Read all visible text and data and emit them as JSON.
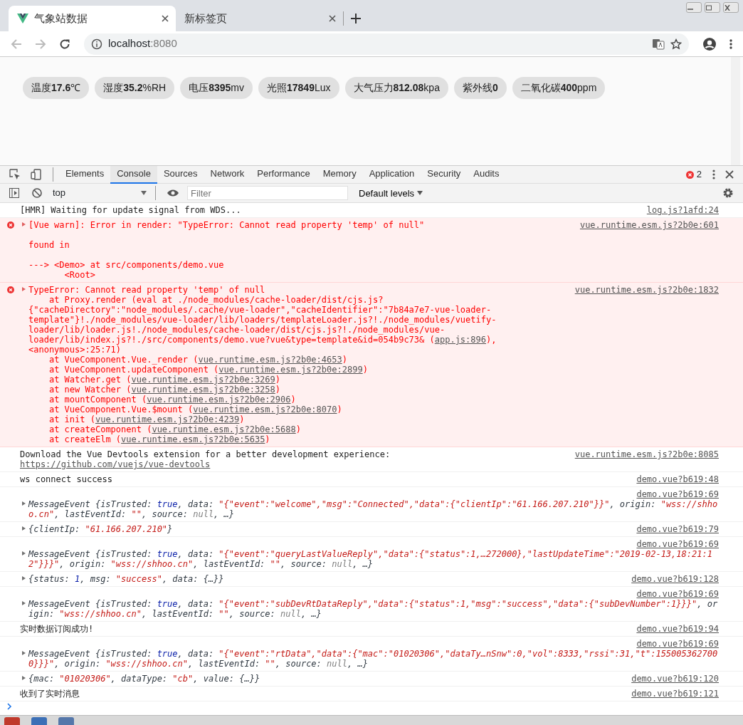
{
  "browser": {
    "tabs": [
      {
        "title": "气象站数据",
        "selected": true
      },
      {
        "title": "新标签页",
        "selected": false
      }
    ],
    "address": {
      "host": "localhost",
      "port": ":8080"
    }
  },
  "page": {
    "readings": [
      {
        "text": "温度**17.6**℃"
      },
      {
        "text": "湿度**35.2**%RH"
      },
      {
        "text": "电压**8395**mv"
      },
      {
        "text": "光照**17849**Lux"
      },
      {
        "text": "大气压力**812.08**kpa"
      },
      {
        "text": "紫外线**0**"
      },
      {
        "text": "二氧化碳**400**ppm"
      }
    ]
  },
  "devtools": {
    "tabs": [
      {
        "label": "Elements",
        "selected": false
      },
      {
        "label": "Console",
        "selected": true
      },
      {
        "label": "Sources",
        "selected": false
      },
      {
        "label": "Network",
        "selected": false
      },
      {
        "label": "Performance",
        "selected": false
      },
      {
        "label": "Memory",
        "selected": false
      },
      {
        "label": "Application",
        "selected": false
      },
      {
        "label": "Security",
        "selected": false
      },
      {
        "label": "Audits",
        "selected": false
      }
    ],
    "error_count": "2",
    "context": "top",
    "filter": {
      "placeholder": "Filter"
    },
    "levels": "Default levels",
    "messages": [
      {
        "kind": "log",
        "expandable": false,
        "source_above": false,
        "source": "log.js?1afd:24",
        "segments": [
          {
            "kind": "text",
            "text": "[HMR] Waiting for update signal from WDS..."
          }
        ]
      },
      {
        "kind": "error",
        "expandable": true,
        "source_above": false,
        "source": "vue.runtime.esm.js?2b0e:601",
        "segments": [
          {
            "kind": "text",
            "text": "[Vue warn]: Error in render: \"TypeError: Cannot read property 'temp' of null\"\n\nfound in\n\n---> <Demo> at src/components/demo.vue\n       <Root>"
          }
        ]
      },
      {
        "kind": "error",
        "expandable": true,
        "source_above": false,
        "source": "vue.runtime.esm.js?2b0e:1832",
        "segments": [
          {
            "kind": "text",
            "text": "TypeError: Cannot read property 'temp' of null\n    at Proxy.render (eval at ./node_modules/cache-loader/dist/cjs.js?{\"cacheDirectory\":\"node_modules/.cache/vue-loader\",\"cacheIdentifier\":\"7b84a7e7-vue-loader-template\"}!./node_modules/vue-loader/lib/loaders/templateLoader.js?!./node_modules/vuetify-loader/lib/loader.js!./node_modules/cache-loader/dist/cjs.js?!./node_modules/vue-loader/lib/index.js?!./src/components/demo.vue?vue&type=template&id=054b9c73& ("
          },
          {
            "kind": "link",
            "text": "app.js:896"
          },
          {
            "kind": "text",
            "text": "), <anonymous>:25:71)\n    at VueComponent.Vue._render ("
          },
          {
            "kind": "link",
            "text": "vue.runtime.esm.js?2b0e:4653"
          },
          {
            "kind": "text",
            "text": ")\n    at VueComponent.updateComponent ("
          },
          {
            "kind": "link",
            "text": "vue.runtime.esm.js?2b0e:2899"
          },
          {
            "kind": "text",
            "text": ")\n    at Watcher.get ("
          },
          {
            "kind": "link",
            "text": "vue.runtime.esm.js?2b0e:3269"
          },
          {
            "kind": "text",
            "text": ")\n    at new Watcher ("
          },
          {
            "kind": "link",
            "text": "vue.runtime.esm.js?2b0e:3258"
          },
          {
            "kind": "text",
            "text": ")\n    at mountComponent ("
          },
          {
            "kind": "link",
            "text": "vue.runtime.esm.js?2b0e:2906"
          },
          {
            "kind": "text",
            "text": ")\n    at VueComponent.Vue.$mount ("
          },
          {
            "kind": "link",
            "text": "vue.runtime.esm.js?2b0e:8070"
          },
          {
            "kind": "text",
            "text": ")\n    at init ("
          },
          {
            "kind": "link",
            "text": "vue.runtime.esm.js?2b0e:4239"
          },
          {
            "kind": "text",
            "text": ")\n    at createComponent ("
          },
          {
            "kind": "link",
            "text": "vue.runtime.esm.js?2b0e:5688"
          },
          {
            "kind": "text",
            "text": ")\n    at createElm ("
          },
          {
            "kind": "link",
            "text": "vue.runtime.esm.js?2b0e:5635"
          },
          {
            "kind": "text",
            "text": ")"
          }
        ]
      },
      {
        "kind": "log",
        "expandable": false,
        "source_above": false,
        "source": "vue.runtime.esm.js?2b0e:8085",
        "segments": [
          {
            "kind": "text",
            "text": "Download the Vue Devtools extension for a better development experience:\n"
          },
          {
            "kind": "link",
            "text": "https://github.com/vuejs/vue-devtools"
          }
        ]
      },
      {
        "kind": "log",
        "expandable": false,
        "source_above": false,
        "source": "demo.vue?b619:48",
        "segments": [
          {
            "kind": "text",
            "text": "ws connect success"
          }
        ]
      },
      {
        "kind": "object",
        "expandable": true,
        "source_above": true,
        "source": "demo.vue?b619:69",
        "segments": [
          {
            "kind": "text",
            "text": "MessageEvent {isTrusted: "
          },
          {
            "kind": "keyword",
            "text": "true"
          },
          {
            "kind": "text",
            "text": ", data: "
          },
          {
            "kind": "string",
            "text": "\"{\"event\":\"welcome\",\"msg\":\"Connected\",\"data\":{\"clientIp\":\"61.166.207.210\"}}\""
          },
          {
            "kind": "text",
            "text": ", origin: "
          },
          {
            "kind": "string",
            "text": "\"wss://shhoo.cn\""
          },
          {
            "kind": "text",
            "text": ", lastEventId: "
          },
          {
            "kind": "string",
            "text": "\"\""
          },
          {
            "kind": "text",
            "text": ", source: "
          },
          {
            "kind": "null",
            "text": "null"
          },
          {
            "kind": "text",
            "text": ", …}"
          }
        ]
      },
      {
        "kind": "object",
        "expandable": true,
        "source_above": false,
        "source": "demo.vue?b619:79",
        "segments": [
          {
            "kind": "text",
            "text": "{clientIp: "
          },
          {
            "kind": "string",
            "text": "\"61.166.207.210\""
          },
          {
            "kind": "text",
            "text": "}"
          }
        ]
      },
      {
        "kind": "object",
        "expandable": true,
        "source_above": true,
        "source": "demo.vue?b619:69",
        "segments": [
          {
            "kind": "text",
            "text": "MessageEvent {isTrusted: "
          },
          {
            "kind": "keyword",
            "text": "true"
          },
          {
            "kind": "text",
            "text": ", data: "
          },
          {
            "kind": "string",
            "text": "\"{\"event\":\"queryLastValueReply\",\"data\":{\"status\":1,…272000},\"lastUpdateTime\":\"2019-02-13,18:21:12\"}}}\""
          },
          {
            "kind": "text",
            "text": ", origin: "
          },
          {
            "kind": "string",
            "text": "\"wss://shhoo.cn\""
          },
          {
            "kind": "text",
            "text": ", lastEventId: "
          },
          {
            "kind": "string",
            "text": "\"\""
          },
          {
            "kind": "text",
            "text": ", source: "
          },
          {
            "kind": "null",
            "text": "null"
          },
          {
            "kind": "text",
            "text": ", …}"
          }
        ]
      },
      {
        "kind": "object",
        "expandable": true,
        "source_above": false,
        "source": "demo.vue?b619:128",
        "segments": [
          {
            "kind": "text",
            "text": "{status: "
          },
          {
            "kind": "keyword",
            "text": "1"
          },
          {
            "kind": "text",
            "text": ", msg: "
          },
          {
            "kind": "string",
            "text": "\"success\""
          },
          {
            "kind": "text",
            "text": ", data: {…}}"
          }
        ]
      },
      {
        "kind": "object",
        "expandable": true,
        "source_above": true,
        "source": "demo.vue?b619:69",
        "segments": [
          {
            "kind": "text",
            "text": "MessageEvent {isTrusted: "
          },
          {
            "kind": "keyword",
            "text": "true"
          },
          {
            "kind": "text",
            "text": ", data: "
          },
          {
            "kind": "string",
            "text": "\"{\"event\":\"subDevRtDataReply\",\"data\":{\"status\":1,\"msg\":\"success\",\"data\":{\"subDevNumber\":1}}}\""
          },
          {
            "kind": "text",
            "text": ", origin: "
          },
          {
            "kind": "string",
            "text": "\"wss://shhoo.cn\""
          },
          {
            "kind": "text",
            "text": ", lastEventId: "
          },
          {
            "kind": "string",
            "text": "\"\""
          },
          {
            "kind": "text",
            "text": ", source: "
          },
          {
            "kind": "null",
            "text": "null"
          },
          {
            "kind": "text",
            "text": ", …}"
          }
        ]
      },
      {
        "kind": "log",
        "expandable": false,
        "source_above": false,
        "source": "demo.vue?b619:94",
        "segments": [
          {
            "kind": "text",
            "text": "实时数据订阅成功!"
          }
        ]
      },
      {
        "kind": "object",
        "expandable": true,
        "source_above": true,
        "source": "demo.vue?b619:69",
        "segments": [
          {
            "kind": "text",
            "text": "MessageEvent {isTrusted: "
          },
          {
            "kind": "keyword",
            "text": "true"
          },
          {
            "kind": "text",
            "text": ", data: "
          },
          {
            "kind": "string",
            "text": "\"{\"event\":\"rtData\",\"data\":{\"mac\":\"01020306\",\"dataTy…nSnw\":0,\"vol\":8333,\"rssi\":31,\"t\":1550053627000}}}\""
          },
          {
            "kind": "text",
            "text": ", origin: "
          },
          {
            "kind": "string",
            "text": "\"wss://shhoo.cn\""
          },
          {
            "kind": "text",
            "text": ", lastEventId: "
          },
          {
            "kind": "string",
            "text": "\"\""
          },
          {
            "kind": "text",
            "text": ", source: "
          },
          {
            "kind": "null",
            "text": "null"
          },
          {
            "kind": "text",
            "text": ", …}"
          }
        ]
      },
      {
        "kind": "object",
        "expandable": true,
        "source_above": false,
        "source": "demo.vue?b619:120",
        "segments": [
          {
            "kind": "text",
            "text": "{mac: "
          },
          {
            "kind": "string",
            "text": "\"01020306\""
          },
          {
            "kind": "text",
            "text": ", dataType: "
          },
          {
            "kind": "string",
            "text": "\"cb\""
          },
          {
            "kind": "text",
            "text": ", value: {…}}"
          }
        ]
      },
      {
        "kind": "log",
        "expandable": false,
        "source_above": false,
        "source": "demo.vue?b619:121",
        "segments": [
          {
            "kind": "text",
            "text": "收到了实时消息"
          }
        ]
      }
    ]
  }
}
